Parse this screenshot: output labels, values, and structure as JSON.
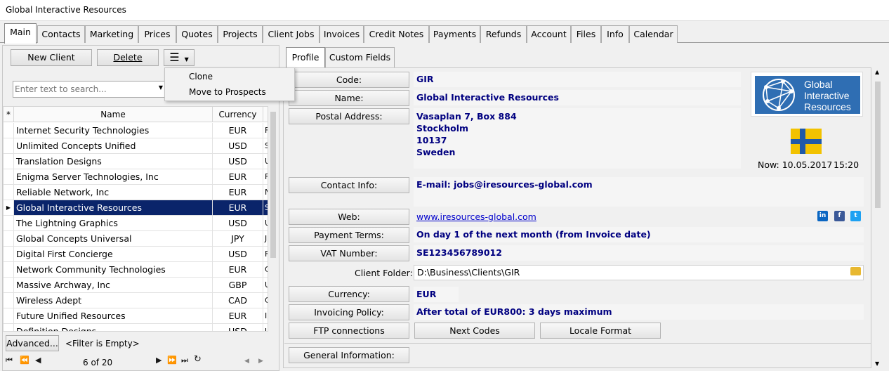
{
  "window": {
    "title": "Global Interactive Resources"
  },
  "tabs": [
    "Main",
    "Contacts",
    "Marketing",
    "Prices",
    "Quotes",
    "Projects",
    "Client Jobs",
    "Invoices",
    "Credit Notes",
    "Payments",
    "Refunds",
    "Account",
    "Files",
    "Info",
    "Calendar"
  ],
  "toolbar": {
    "new_client": "New Client",
    "delete": "Delete"
  },
  "menu": {
    "items": [
      "Clone",
      "Move to Prospects"
    ]
  },
  "search": {
    "placeholder": "Enter text to search..."
  },
  "grid": {
    "columns": {
      "marker": "*",
      "name": "Name",
      "currency": "Currency"
    },
    "rows": [
      {
        "name": "Internet Security Technologies",
        "currency": "EUR",
        "extra": "F"
      },
      {
        "name": "Unlimited Concepts Unified",
        "currency": "USD",
        "extra": "S"
      },
      {
        "name": "Translation Designs",
        "currency": "USD",
        "extra": "U"
      },
      {
        "name": "Enigma Server Technologies, Inc",
        "currency": "EUR",
        "extra": "F"
      },
      {
        "name": "Reliable Network, Inc",
        "currency": "EUR",
        "extra": "N"
      },
      {
        "name": "Global Interactive Resources",
        "currency": "EUR",
        "extra": "S"
      },
      {
        "name": "The Lightning Graphics",
        "currency": "USD",
        "extra": "U"
      },
      {
        "name": "Global Concepts Universal",
        "currency": "JPY",
        "extra": "J"
      },
      {
        "name": "Digital First Concierge",
        "currency": "USD",
        "extra": "F"
      },
      {
        "name": "Network Community Technologies",
        "currency": "EUR",
        "extra": "C"
      },
      {
        "name": "Massive Archway, Inc",
        "currency": "GBP",
        "extra": "U"
      },
      {
        "name": "Wireless Adept",
        "currency": "CAD",
        "extra": "C"
      },
      {
        "name": "Future Unified Resources",
        "currency": "EUR",
        "extra": "I"
      },
      {
        "name": "Definition Designs",
        "currency": "USD",
        "extra": "U"
      }
    ],
    "selected_index": 5
  },
  "filter": {
    "advanced": "Advanced...",
    "status": "<Filter is Empty>"
  },
  "pager": {
    "text": "6 of 20"
  },
  "subtabs": [
    "Profile",
    "Custom Fields"
  ],
  "profile": {
    "code_label": "Code:",
    "code": "GIR",
    "name_label": "Name:",
    "name": "Global Interactive Resources",
    "postal_label": "Postal Address:",
    "postal_lines": [
      "Vasaplan 7, Box 884",
      "Stockholm",
      "10137",
      "Sweden"
    ],
    "contact_label": "Contact Info:",
    "contact": "E-mail: jobs@iresources-global.com",
    "web_label": "Web:",
    "web": "www.iresources-global.com",
    "payment_label": "Payment Terms:",
    "payment": "On day 1 of the next month (from Invoice date)",
    "vat_label": "VAT Number:",
    "vat": "SE123456789012",
    "folder_label": "Client Folder:",
    "folder": "D:\\Business\\Clients\\GIR",
    "currency_label": "Currency:",
    "currency": "EUR",
    "invoicing_label": "Invoicing Policy:",
    "invoicing": "After total of EUR800: 3 days maximum",
    "ftp_label": "FTP connections",
    "next_codes": "Next Codes",
    "locale": "Locale Format",
    "general_label": "General Information:"
  },
  "logo": {
    "lines": [
      "Global",
      "Interactive",
      "Resources"
    ]
  },
  "clock": {
    "date": "Now: 10.05.2017",
    "time": "15:20"
  },
  "social": {
    "linkedin": "in",
    "facebook": "f",
    "twitter": "t"
  }
}
